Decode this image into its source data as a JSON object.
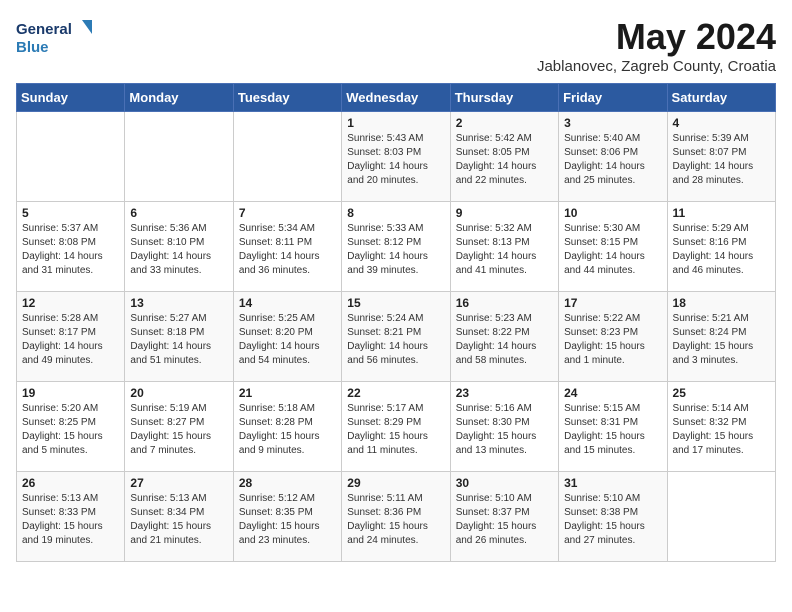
{
  "logo": {
    "line1": "General",
    "line2": "Blue"
  },
  "title": "May 2024",
  "location": "Jablanovec, Zagreb County, Croatia",
  "days_of_week": [
    "Sunday",
    "Monday",
    "Tuesday",
    "Wednesday",
    "Thursday",
    "Friday",
    "Saturday"
  ],
  "weeks": [
    [
      {
        "day": "",
        "info": ""
      },
      {
        "day": "",
        "info": ""
      },
      {
        "day": "",
        "info": ""
      },
      {
        "day": "1",
        "info": "Sunrise: 5:43 AM\nSunset: 8:03 PM\nDaylight: 14 hours\nand 20 minutes."
      },
      {
        "day": "2",
        "info": "Sunrise: 5:42 AM\nSunset: 8:05 PM\nDaylight: 14 hours\nand 22 minutes."
      },
      {
        "day": "3",
        "info": "Sunrise: 5:40 AM\nSunset: 8:06 PM\nDaylight: 14 hours\nand 25 minutes."
      },
      {
        "day": "4",
        "info": "Sunrise: 5:39 AM\nSunset: 8:07 PM\nDaylight: 14 hours\nand 28 minutes."
      }
    ],
    [
      {
        "day": "5",
        "info": "Sunrise: 5:37 AM\nSunset: 8:08 PM\nDaylight: 14 hours\nand 31 minutes."
      },
      {
        "day": "6",
        "info": "Sunrise: 5:36 AM\nSunset: 8:10 PM\nDaylight: 14 hours\nand 33 minutes."
      },
      {
        "day": "7",
        "info": "Sunrise: 5:34 AM\nSunset: 8:11 PM\nDaylight: 14 hours\nand 36 minutes."
      },
      {
        "day": "8",
        "info": "Sunrise: 5:33 AM\nSunset: 8:12 PM\nDaylight: 14 hours\nand 39 minutes."
      },
      {
        "day": "9",
        "info": "Sunrise: 5:32 AM\nSunset: 8:13 PM\nDaylight: 14 hours\nand 41 minutes."
      },
      {
        "day": "10",
        "info": "Sunrise: 5:30 AM\nSunset: 8:15 PM\nDaylight: 14 hours\nand 44 minutes."
      },
      {
        "day": "11",
        "info": "Sunrise: 5:29 AM\nSunset: 8:16 PM\nDaylight: 14 hours\nand 46 minutes."
      }
    ],
    [
      {
        "day": "12",
        "info": "Sunrise: 5:28 AM\nSunset: 8:17 PM\nDaylight: 14 hours\nand 49 minutes."
      },
      {
        "day": "13",
        "info": "Sunrise: 5:27 AM\nSunset: 8:18 PM\nDaylight: 14 hours\nand 51 minutes."
      },
      {
        "day": "14",
        "info": "Sunrise: 5:25 AM\nSunset: 8:20 PM\nDaylight: 14 hours\nand 54 minutes."
      },
      {
        "day": "15",
        "info": "Sunrise: 5:24 AM\nSunset: 8:21 PM\nDaylight: 14 hours\nand 56 minutes."
      },
      {
        "day": "16",
        "info": "Sunrise: 5:23 AM\nSunset: 8:22 PM\nDaylight: 14 hours\nand 58 minutes."
      },
      {
        "day": "17",
        "info": "Sunrise: 5:22 AM\nSunset: 8:23 PM\nDaylight: 15 hours\nand 1 minute."
      },
      {
        "day": "18",
        "info": "Sunrise: 5:21 AM\nSunset: 8:24 PM\nDaylight: 15 hours\nand 3 minutes."
      }
    ],
    [
      {
        "day": "19",
        "info": "Sunrise: 5:20 AM\nSunset: 8:25 PM\nDaylight: 15 hours\nand 5 minutes."
      },
      {
        "day": "20",
        "info": "Sunrise: 5:19 AM\nSunset: 8:27 PM\nDaylight: 15 hours\nand 7 minutes."
      },
      {
        "day": "21",
        "info": "Sunrise: 5:18 AM\nSunset: 8:28 PM\nDaylight: 15 hours\nand 9 minutes."
      },
      {
        "day": "22",
        "info": "Sunrise: 5:17 AM\nSunset: 8:29 PM\nDaylight: 15 hours\nand 11 minutes."
      },
      {
        "day": "23",
        "info": "Sunrise: 5:16 AM\nSunset: 8:30 PM\nDaylight: 15 hours\nand 13 minutes."
      },
      {
        "day": "24",
        "info": "Sunrise: 5:15 AM\nSunset: 8:31 PM\nDaylight: 15 hours\nand 15 minutes."
      },
      {
        "day": "25",
        "info": "Sunrise: 5:14 AM\nSunset: 8:32 PM\nDaylight: 15 hours\nand 17 minutes."
      }
    ],
    [
      {
        "day": "26",
        "info": "Sunrise: 5:13 AM\nSunset: 8:33 PM\nDaylight: 15 hours\nand 19 minutes."
      },
      {
        "day": "27",
        "info": "Sunrise: 5:13 AM\nSunset: 8:34 PM\nDaylight: 15 hours\nand 21 minutes."
      },
      {
        "day": "28",
        "info": "Sunrise: 5:12 AM\nSunset: 8:35 PM\nDaylight: 15 hours\nand 23 minutes."
      },
      {
        "day": "29",
        "info": "Sunrise: 5:11 AM\nSunset: 8:36 PM\nDaylight: 15 hours\nand 24 minutes."
      },
      {
        "day": "30",
        "info": "Sunrise: 5:10 AM\nSunset: 8:37 PM\nDaylight: 15 hours\nand 26 minutes."
      },
      {
        "day": "31",
        "info": "Sunrise: 5:10 AM\nSunset: 8:38 PM\nDaylight: 15 hours\nand 27 minutes."
      },
      {
        "day": "",
        "info": ""
      }
    ]
  ]
}
